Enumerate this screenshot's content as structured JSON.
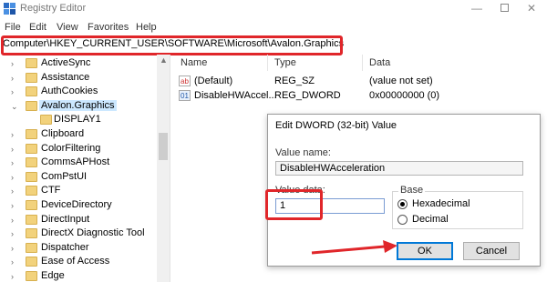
{
  "window": {
    "title": "Registry Editor",
    "minimize_glyph": "—",
    "close_glyph": "✕"
  },
  "menu": [
    "File",
    "Edit",
    "View",
    "Favorites",
    "Help"
  ],
  "address": "Computer\\HKEY_CURRENT_USER\\SOFTWARE\\Microsoft\\Avalon.Graphics",
  "tree": {
    "items": [
      {
        "label": "ActiveSync",
        "expandable": true
      },
      {
        "label": "Assistance",
        "expandable": true
      },
      {
        "label": "AuthCookies",
        "expandable": true
      },
      {
        "label": "Avalon.Graphics",
        "expandable": true,
        "expanded": true,
        "selected": true
      },
      {
        "label": "DISPLAY1",
        "expandable": false,
        "child": true
      },
      {
        "label": "Clipboard",
        "expandable": true
      },
      {
        "label": "ColorFiltering",
        "expandable": true
      },
      {
        "label": "CommsAPHost",
        "expandable": true
      },
      {
        "label": "ComPstUI",
        "expandable": true
      },
      {
        "label": "CTF",
        "expandable": true
      },
      {
        "label": "DeviceDirectory",
        "expandable": true
      },
      {
        "label": "DirectInput",
        "expandable": true
      },
      {
        "label": "DirectX Diagnostic Tool",
        "expandable": true
      },
      {
        "label": "Dispatcher",
        "expandable": true
      },
      {
        "label": "Ease of Access",
        "expandable": true
      },
      {
        "label": "Edge",
        "expandable": true
      }
    ]
  },
  "values": {
    "headers": {
      "name": "Name",
      "type": "Type",
      "data": "Data"
    },
    "rows": [
      {
        "icon": "string-value-icon",
        "icon_text": "ab",
        "name": "(Default)",
        "type": "REG_SZ",
        "data": "(value not set)"
      },
      {
        "icon": "dword-value-icon",
        "icon_text": "01",
        "name": "DisableHWAccel...",
        "type": "REG_DWORD",
        "data": "0x00000000 (0)"
      }
    ]
  },
  "dialog": {
    "title": "Edit DWORD (32-bit) Value",
    "value_name_label": "Value name:",
    "value_name": "DisableHWAcceleration",
    "value_data_label": "Value data:",
    "value_data": "1",
    "base_label": "Base",
    "base_options": [
      "Hexadecimal",
      "Decimal"
    ],
    "base_selected": "Hexadecimal",
    "ok_label": "OK",
    "cancel_label": "Cancel"
  },
  "colors": {
    "highlight": "#e0262a",
    "selection": "#cce8ff",
    "folder": "#f2d27c"
  }
}
